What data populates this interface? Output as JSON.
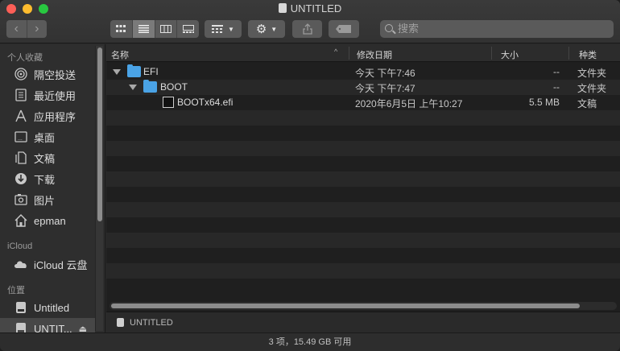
{
  "window": {
    "title": "UNTITLED"
  },
  "toolbar": {
    "back_icon": "chevron-left-icon",
    "forward_icon": "chevron-right-icon",
    "search_placeholder": "搜索"
  },
  "sidebar": {
    "sections": [
      {
        "label": "个人收藏"
      },
      {
        "label": "iCloud"
      },
      {
        "label": "位置"
      }
    ],
    "items": [
      {
        "label": "隔空投送",
        "icon": "airdrop-icon"
      },
      {
        "label": "最近使用",
        "icon": "recents-icon"
      },
      {
        "label": "应用程序",
        "icon": "applications-icon"
      },
      {
        "label": "桌面",
        "icon": "desktop-icon"
      },
      {
        "label": "文稿",
        "icon": "documents-icon"
      },
      {
        "label": "下载",
        "icon": "downloads-icon"
      },
      {
        "label": "图片",
        "icon": "pictures-icon"
      },
      {
        "label": "epman",
        "icon": "home-icon"
      },
      {
        "label": "iCloud 云盘",
        "icon": "cloud-icon"
      },
      {
        "label": "Untitled",
        "icon": "disk-icon"
      },
      {
        "label": "UNTIT...",
        "icon": "disk-icon",
        "selected": true
      }
    ]
  },
  "columns": {
    "name": "名称",
    "date": "修改日期",
    "size": "大小",
    "kind": "种类"
  },
  "rows": [
    {
      "name": "EFI",
      "date": "今天 下午7:46",
      "size": "--",
      "kind": "文件夹"
    },
    {
      "name": "BOOT",
      "date": "今天 下午7:47",
      "size": "--",
      "kind": "文件夹"
    },
    {
      "name": "BOOTx64.efi",
      "date": "2020年6月5日 上午10:27",
      "size": "5.5 MB",
      "kind": "文稿"
    }
  ],
  "pathbar": {
    "label": "UNTITLED"
  },
  "status": {
    "text": "3 项，15.49 GB 可用"
  }
}
